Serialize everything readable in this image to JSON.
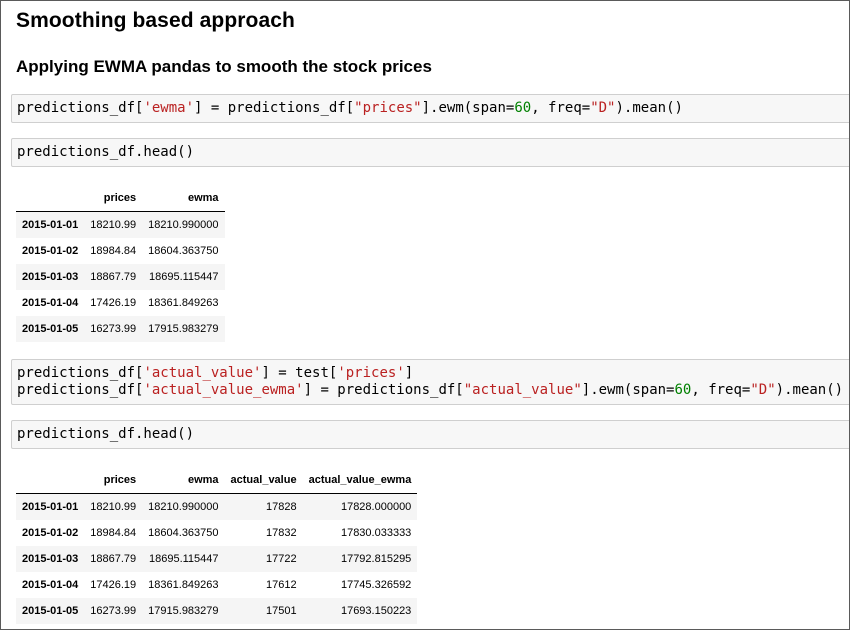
{
  "headings": {
    "title": "Smoothing based approach",
    "subtitle": "Applying EWMA pandas to smooth the stock prices"
  },
  "cell1": {
    "p1": "predictions_df[",
    "s1": "'ewma'",
    "p2": "] = predictions_df[",
    "s2": "\"prices\"",
    "p3": "].ewm(span=",
    "n1": "60",
    "p4": ", freq=",
    "s3": "\"D\"",
    "p5": ").mean()"
  },
  "cell2": {
    "code": "predictions_df.head()"
  },
  "table1": {
    "columns": [
      "prices",
      "ewma"
    ],
    "rows": [
      {
        "index": "2015-01-01",
        "prices": "18210.99",
        "ewma": "18210.990000"
      },
      {
        "index": "2015-01-02",
        "prices": "18984.84",
        "ewma": "18604.363750"
      },
      {
        "index": "2015-01-03",
        "prices": "18867.79",
        "ewma": "18695.115447"
      },
      {
        "index": "2015-01-04",
        "prices": "17426.19",
        "ewma": "18361.849263"
      },
      {
        "index": "2015-01-05",
        "prices": "16273.99",
        "ewma": "17915.983279"
      }
    ]
  },
  "cell3": {
    "l1p1": "predictions_df[",
    "l1s1": "'actual_value'",
    "l1p2": "] = test[",
    "l1s2": "'prices'",
    "l1p3": "]",
    "l2p1": "predictions_df[",
    "l2s1": "'actual_value_ewma'",
    "l2p2": "] = predictions_df[",
    "l2s2": "\"actual_value\"",
    "l2p3": "].ewm(span=",
    "l2n1": "60",
    "l2p4": ", freq=",
    "l2s3": "\"D\"",
    "l2p5": ").mean()"
  },
  "cell4": {
    "code": "predictions_df.head()"
  },
  "table2": {
    "columns": [
      "prices",
      "ewma",
      "actual_value",
      "actual_value_ewma"
    ],
    "rows": [
      {
        "index": "2015-01-01",
        "prices": "18210.99",
        "ewma": "18210.990000",
        "actual_value": "17828",
        "actual_value_ewma": "17828.000000"
      },
      {
        "index": "2015-01-02",
        "prices": "18984.84",
        "ewma": "18604.363750",
        "actual_value": "17832",
        "actual_value_ewma": "17830.033333"
      },
      {
        "index": "2015-01-03",
        "prices": "18867.79",
        "ewma": "18695.115447",
        "actual_value": "17722",
        "actual_value_ewma": "17792.815295"
      },
      {
        "index": "2015-01-04",
        "prices": "17426.19",
        "ewma": "18361.849263",
        "actual_value": "17612",
        "actual_value_ewma": "17745.326592"
      },
      {
        "index": "2015-01-05",
        "prices": "16273.99",
        "ewma": "17915.983279",
        "actual_value": "17501",
        "actual_value_ewma": "17693.150223"
      }
    ]
  }
}
